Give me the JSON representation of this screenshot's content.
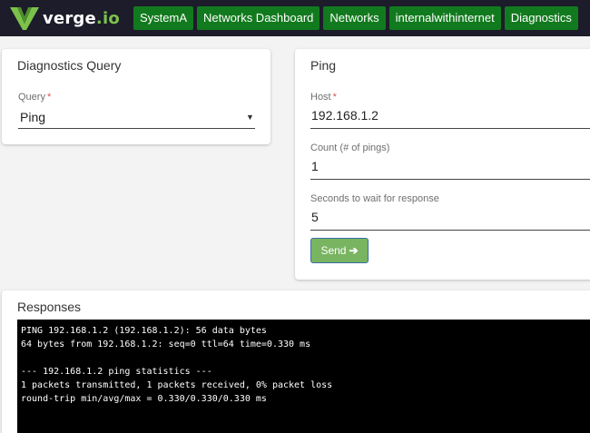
{
  "brand": {
    "name": "verge",
    "suffix": ".io",
    "accent": "#7cc24a"
  },
  "breadcrumbs": [
    "SystemA",
    "Networks Dashboard",
    "Networks",
    "internalwithinternet",
    "Diagnostics"
  ],
  "colors": {
    "topbar": "#1c1c2b",
    "crumb": "#127a1e",
    "send_button": "#79b461",
    "required": "#d9534f"
  },
  "diagnostics_query": {
    "title": "Diagnostics Query",
    "query_label": "Query",
    "query_required": "*",
    "query_value": "Ping",
    "dropdown_icon": "triangle-down-icon"
  },
  "ping": {
    "title": "Ping",
    "host_label": "Host",
    "host_required": "*",
    "host_value": "192.168.1.2",
    "count_label": "Count (# of pings)",
    "count_value": "1",
    "wait_label": "Seconds to wait for response",
    "wait_value": "5",
    "send_label": "Send",
    "send_icon": "arrow-right-icon"
  },
  "responses": {
    "title": "Responses",
    "output": "PING 192.168.1.2 (192.168.1.2): 56 data bytes\n64 bytes from 192.168.1.2: seq=0 ttl=64 time=0.330 ms\n\n--- 192.168.1.2 ping statistics ---\n1 packets transmitted, 1 packets received, 0% packet loss\nround-trip min/avg/max = 0.330/0.330/0.330 ms"
  }
}
